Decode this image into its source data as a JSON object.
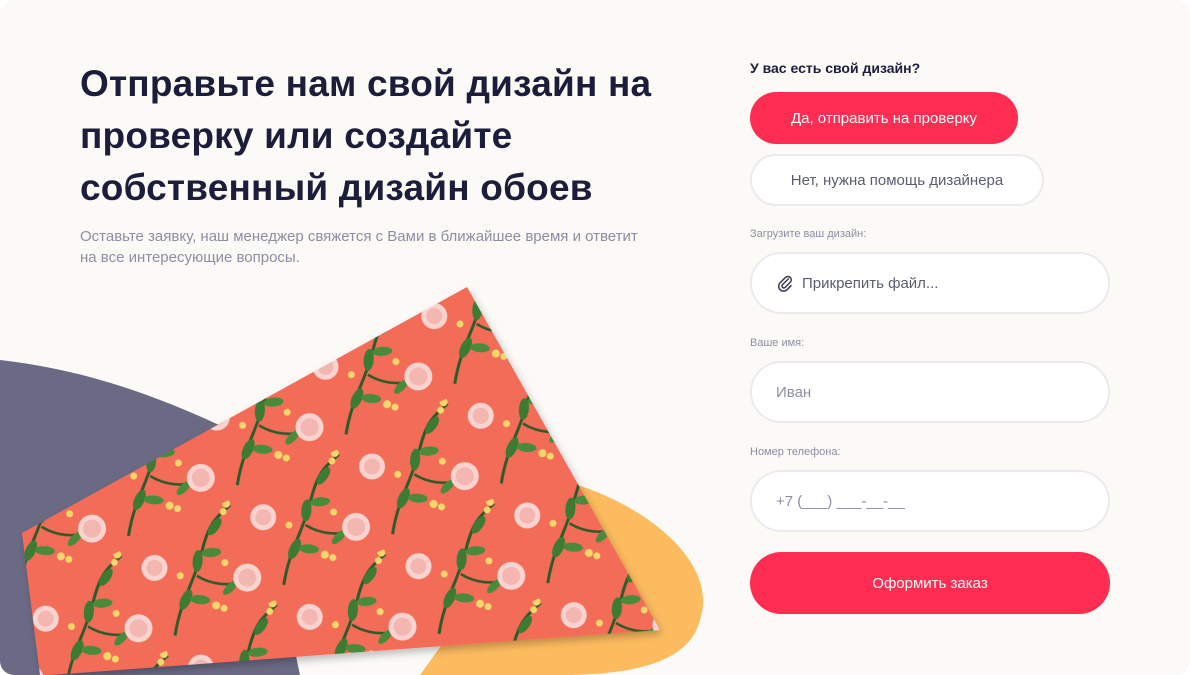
{
  "hero": {
    "title": "Отправьте нам свой дизайн на проверку или создайте собственный дизайн обоев",
    "subtitle": "Оставьте заявку, наш менеджер свяжется с Вами в ближайшее время и ответит на все интересующие вопросы."
  },
  "form": {
    "question": "У вас есть свой дизайн?",
    "yes_label": "Да, отправить на проверку",
    "no_label": "Нет, нужна помощь дизайнера",
    "upload_label": "Загрузите ваш дизайн:",
    "upload_text": "Прикрепить файл...",
    "upload_icon": "paperclip-icon",
    "name_label": "Ваше имя:",
    "name_placeholder": "Иван",
    "phone_label": "Номер телефона:",
    "phone_placeholder": "+7 (___) ___-__-__",
    "submit_label": "Оформить заказ"
  },
  "colors": {
    "accent": "#ff2d51",
    "heading": "#1b1d3a",
    "muted": "#8c8ea3",
    "background": "#fbfaf7",
    "blob_slate": "#6b6a85",
    "blob_yellow": "#fdbb5f",
    "wallpaper": "#f36c58"
  }
}
